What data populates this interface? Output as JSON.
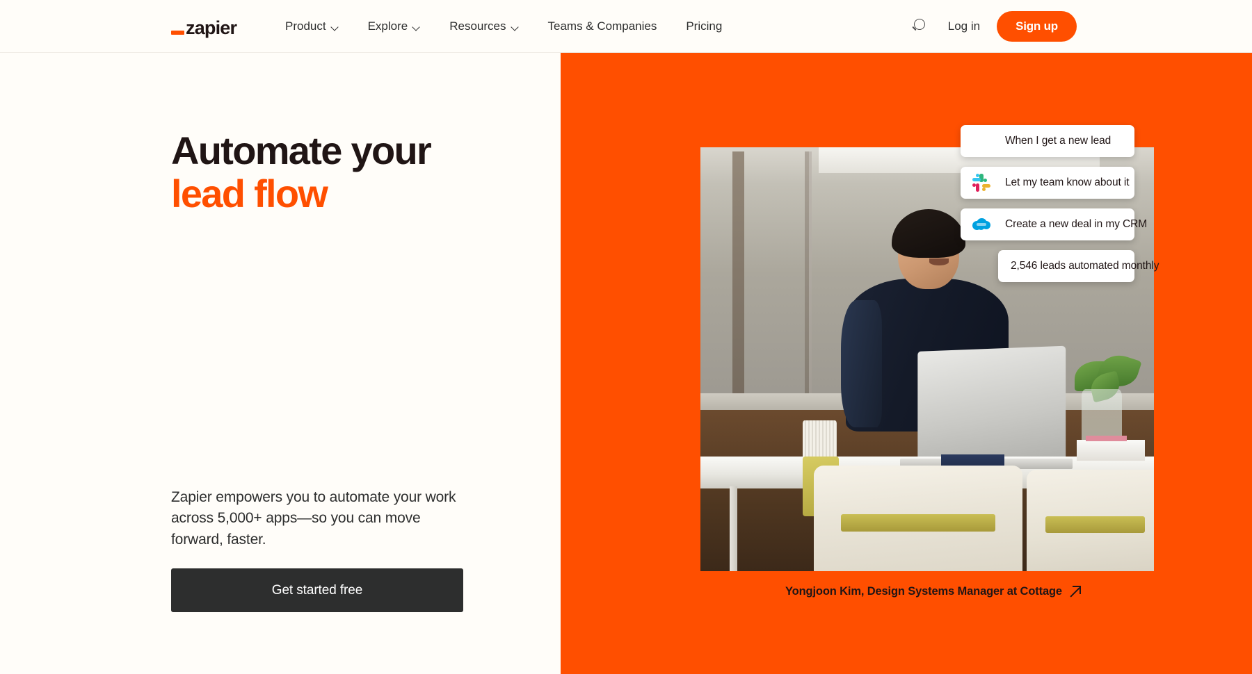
{
  "brand": {
    "logo_text": "zapier",
    "accent_color": "#FF4F00",
    "dark_color": "#201515",
    "cream_background": "#FFFDF9",
    "button_dark": "#2D2E2E"
  },
  "navbar": {
    "links": [
      {
        "label": "Product",
        "has_dropdown": true
      },
      {
        "label": "Explore",
        "has_dropdown": true
      },
      {
        "label": "Resources",
        "has_dropdown": true
      },
      {
        "label": "Teams & Companies",
        "has_dropdown": false
      },
      {
        "label": "Pricing",
        "has_dropdown": false
      }
    ],
    "search_icon": "search-icon",
    "login_label": "Log in",
    "signup_label": "Sign up"
  },
  "hero": {
    "headline_line1": "Automate your",
    "headline_line2": "lead flow",
    "subtext": "Zapier empowers you to automate your work across 5,000+ apps—so you can move forward, faster.",
    "cta_label": "Get started free"
  },
  "panel": {
    "background_color": "#FF4F00",
    "cards": [
      {
        "icon": "facebook-icon",
        "label": "When I get a new lead"
      },
      {
        "icon": "slack-icon",
        "label": "Let my team know about it"
      },
      {
        "icon": "salesforce-icon",
        "label": "Create a new deal in my CRM"
      },
      {
        "icon": null,
        "label": "2,546 leads automated monthly"
      }
    ],
    "caption": "Yongjoon Kim, Design Systems Manager at Cottage",
    "caption_icon": "arrow-up-right-icon"
  }
}
